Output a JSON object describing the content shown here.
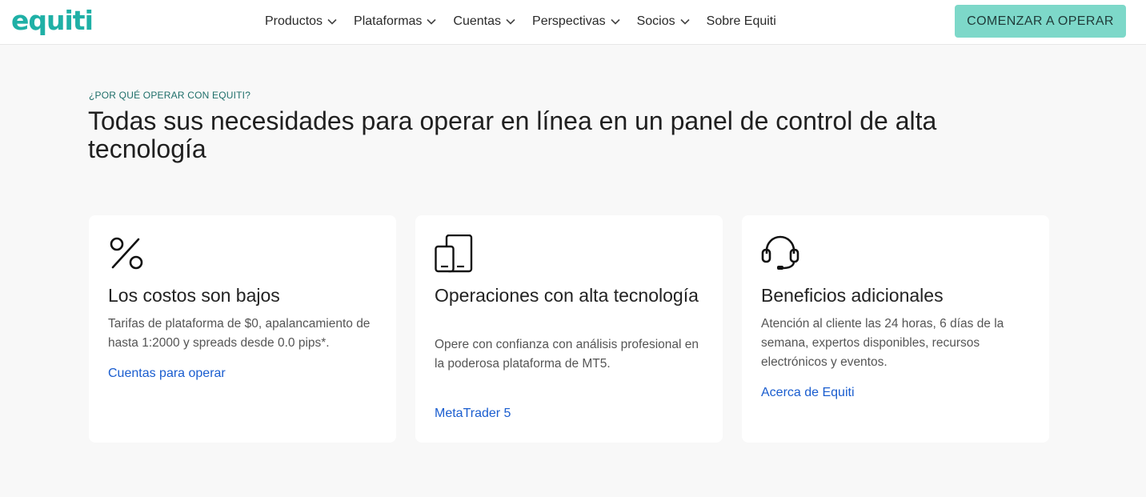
{
  "header": {
    "logo": "equiti",
    "nav": [
      {
        "label": "Productos",
        "has_dropdown": true
      },
      {
        "label": "Plataformas",
        "has_dropdown": true
      },
      {
        "label": "Cuentas",
        "has_dropdown": true
      },
      {
        "label": "Perspectivas",
        "has_dropdown": true
      },
      {
        "label": "Socios",
        "has_dropdown": true
      },
      {
        "label": "Sobre Equiti",
        "has_dropdown": false
      }
    ],
    "cta_label": "COMENZAR A OPERAR"
  },
  "intro": {
    "eyebrow": "¿POR QUÉ OPERAR CON EQUITI?",
    "headline": "Todas sus necesidades para operar en línea en un panel de control de alta tecnología"
  },
  "cards": [
    {
      "icon": "percent-icon",
      "title": "Los costos son bajos",
      "description": "Tarifas de plataforma de $0, apalancamiento de hasta 1:2000 y spreads desde 0.0 pips*.",
      "link": "Cuentas para operar"
    },
    {
      "icon": "devices-icon",
      "title": "Operaciones con alta tecnología",
      "description": "Opere con confianza con análisis profesional en la poderosa plataforma de MT5.",
      "link": "MetaTrader 5"
    },
    {
      "icon": "headset-icon",
      "title": "Beneficios adicionales",
      "description": "Atención al cliente las 24 horas, 6 días de la semana, expertos disponibles, recursos electrónicos y eventos.",
      "link": "Acerca de Equiti"
    }
  ],
  "colors": {
    "brand": "#1fb0a6",
    "cta_bg": "#7dd8c9",
    "link": "#1a5dcf",
    "page_bg": "#f8f8f8"
  }
}
